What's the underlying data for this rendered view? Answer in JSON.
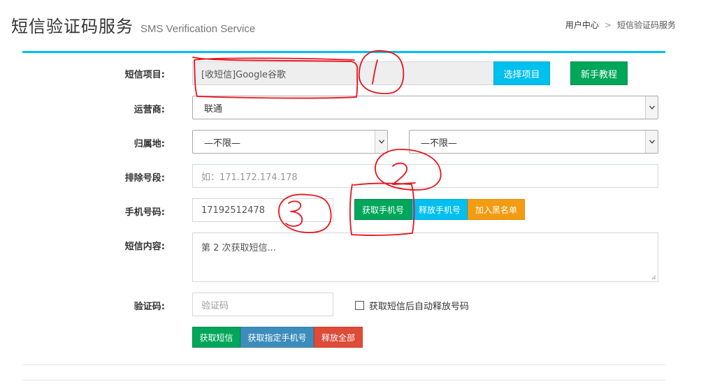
{
  "header": {
    "title": "短信验证码服务",
    "subtitle": "SMS Verification Service"
  },
  "breadcrumb": {
    "home": "用户中心",
    "separator": ">",
    "current": "短信验证码服务"
  },
  "form": {
    "project": {
      "label": "短信项目:",
      "value": "[收短信]Google谷歌",
      "select_button": "选择项目",
      "tutorial_button": "新手教程"
    },
    "carrier": {
      "label": "运营商:",
      "value": "联通"
    },
    "region": {
      "label": "归属地:",
      "province": "—不限—",
      "city": "—不限—"
    },
    "exclude": {
      "label": "排除号段:",
      "placeholder": "如：171.172.174.178"
    },
    "phone": {
      "label": "手机号码:",
      "value": "17192512478",
      "get_button": "获取手机号",
      "release_button": "释放手机号",
      "blacklist_button": "加入黑名单"
    },
    "sms_content": {
      "label": "短信内容:",
      "value": "第 2 次获取短信..."
    },
    "code": {
      "label": "验证码:",
      "placeholder": "验证码",
      "auto_release_label": "获取短信后自动释放号码",
      "auto_release_checked": false
    },
    "actions": {
      "get_sms": "获取短信",
      "get_specific_phone": "获取指定手机号",
      "release_all": "释放全部"
    }
  },
  "annotations": {
    "marks": [
      "1",
      "2",
      "3"
    ],
    "color": "#e8141c"
  },
  "colors": {
    "accent": "#00c0ef",
    "success": "#00a65a",
    "warning": "#f39c12",
    "primary": "#3c8dbc",
    "danger": "#dd4b39"
  }
}
